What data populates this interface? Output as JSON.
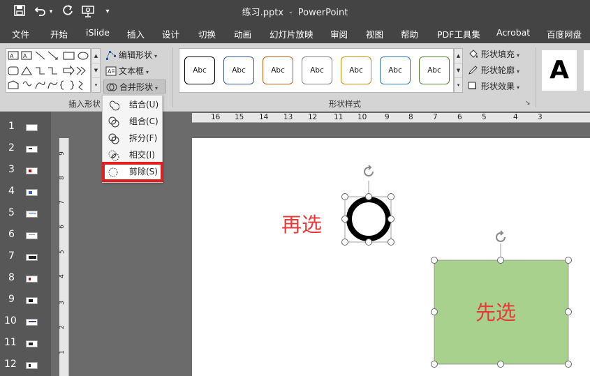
{
  "window": {
    "title_file": "练习.pptx",
    "title_sep": "-",
    "title_app": "PowerPoint"
  },
  "quick_access": {
    "save_icon": "save-icon",
    "undo_icon": "undo-icon",
    "undo_dropdown": "▾",
    "redo_icon": "redo-icon",
    "present_icon": "present-icon",
    "customize_icon": "▾"
  },
  "menu_tabs": [
    "文件",
    "开始",
    "iSlide",
    "插入",
    "设计",
    "切换",
    "动画",
    "幻灯片放映",
    "审阅",
    "视图",
    "帮助",
    "PDF工具集",
    "Acrobat",
    "百度网盘"
  ],
  "ribbon": {
    "insert_shapes_label": "插入形状",
    "edit_shape": "编辑形状",
    "text_box": "文本框",
    "merge_shapes": "合并形状",
    "shape_styles_label": "形状样式",
    "style_thumb_text": "Abc",
    "style_colors": [
      "#000000",
      "#2f5597",
      "#c55a11",
      "#7f7f7f",
      "#bf9000",
      "#2e75b6",
      "#548235"
    ],
    "shape_fill": "形状填充",
    "shape_outline": "形状轮廓",
    "shape_effects": "形状效果",
    "wordart_letter": "A",
    "dropdown_glyph": "▾",
    "launcher_glyph": "↘"
  },
  "merge_menu": {
    "items": [
      {
        "label": "结合(U)",
        "icon": "union-icon"
      },
      {
        "label": "组合(C)",
        "icon": "combine-icon"
      },
      {
        "label": "拆分(F)",
        "icon": "fragment-icon"
      },
      {
        "label": "相交(I)",
        "icon": "intersect-icon"
      },
      {
        "label": "剪除(S)",
        "icon": "subtract-icon"
      }
    ],
    "highlighted_index": 4
  },
  "slides": [
    {
      "num": "1"
    },
    {
      "num": "2"
    },
    {
      "num": "3"
    },
    {
      "num": "4"
    },
    {
      "num": "5"
    },
    {
      "num": "6"
    },
    {
      "num": "7"
    },
    {
      "num": "8"
    },
    {
      "num": "9"
    },
    {
      "num": "10"
    },
    {
      "num": "11"
    },
    {
      "num": "12"
    }
  ],
  "ruler": {
    "horizontal": [
      "16",
      "15",
      "14",
      "13",
      "12",
      "11",
      "10",
      "9",
      "8",
      "7",
      "6",
      "5",
      "4",
      "3"
    ],
    "vertical": [
      "9",
      "8",
      "7",
      "6",
      "5",
      "4",
      "3",
      "2",
      "1"
    ]
  },
  "slide_content": {
    "ring_label": "再选",
    "rect_label": "先选",
    "rect_fill": "#a9d18e",
    "ring_color": "#000000",
    "label_color": "#e53a3a"
  }
}
